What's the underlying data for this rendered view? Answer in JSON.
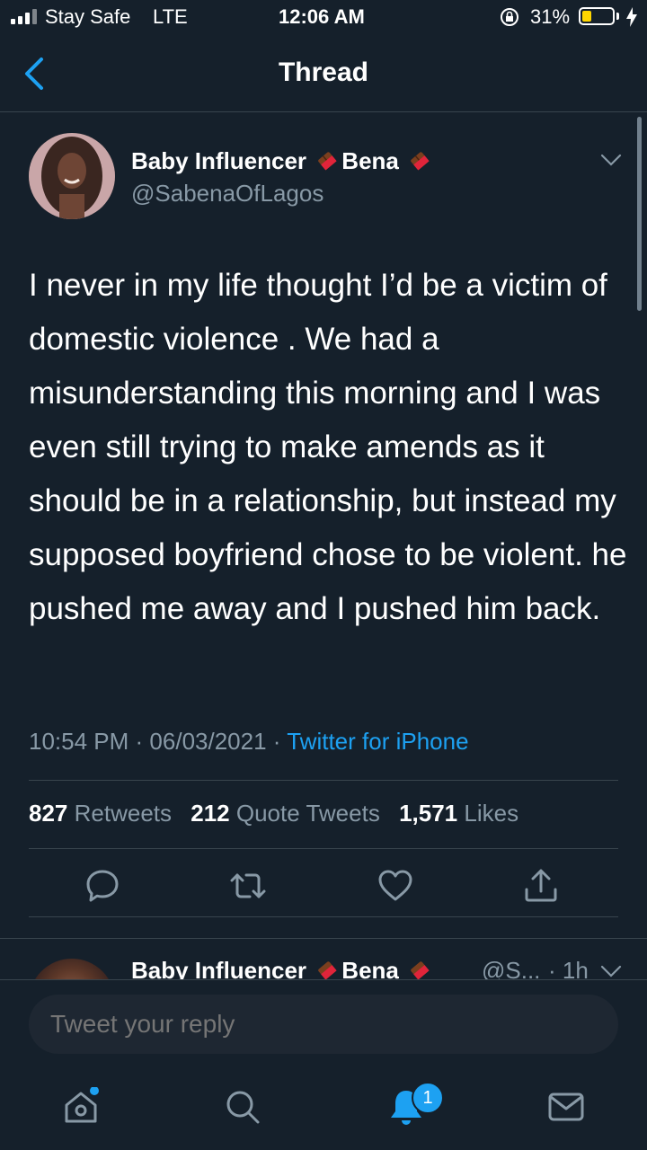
{
  "status_bar": {
    "carrier": "Stay Safe",
    "network": "LTE",
    "time": "12:06 AM",
    "battery_percent": "31%",
    "battery_level": 0.31,
    "battery_color": "#ffd600"
  },
  "header": {
    "title": "Thread"
  },
  "tweet": {
    "author_name": "Baby Influencer",
    "author_name_part2": "Bena",
    "author_handle": "@SabenaOfLagos",
    "text": "I never in my life thought I’d be a victim of domestic violence . We had a misunderstanding this morning and I was even still trying to make amends as it should be in a relationship, but instead my supposed boyfriend chose to be violent. he pushed me away and I pushed him back.",
    "time": "10:54 PM",
    "date": "06/03/2021",
    "source": "Twitter for iPhone",
    "retweets_count": "827",
    "retweets_label": "Retweets",
    "quotes_count": "212",
    "quotes_label": "Quote Tweets",
    "likes_count": "1,571",
    "likes_label": "Likes"
  },
  "next_tweet": {
    "author_name": "Baby Influencer",
    "author_name_part2": "Bena",
    "handle_truncated": "@S...",
    "age": "· 1h"
  },
  "reply": {
    "placeholder": "Tweet your reply"
  },
  "tabs": {
    "notifications_badge": "1"
  },
  "colors": {
    "background": "#15202b",
    "accent": "#1da1f2",
    "muted": "#8899a6",
    "divider": "#38444d"
  },
  "icons": [
    "back-chevron-icon",
    "chevron-down-icon",
    "chocolate-emoji-icon",
    "reply-icon",
    "retweet-icon",
    "like-icon",
    "share-icon",
    "home-icon",
    "search-icon",
    "bell-icon",
    "mail-icon"
  ]
}
